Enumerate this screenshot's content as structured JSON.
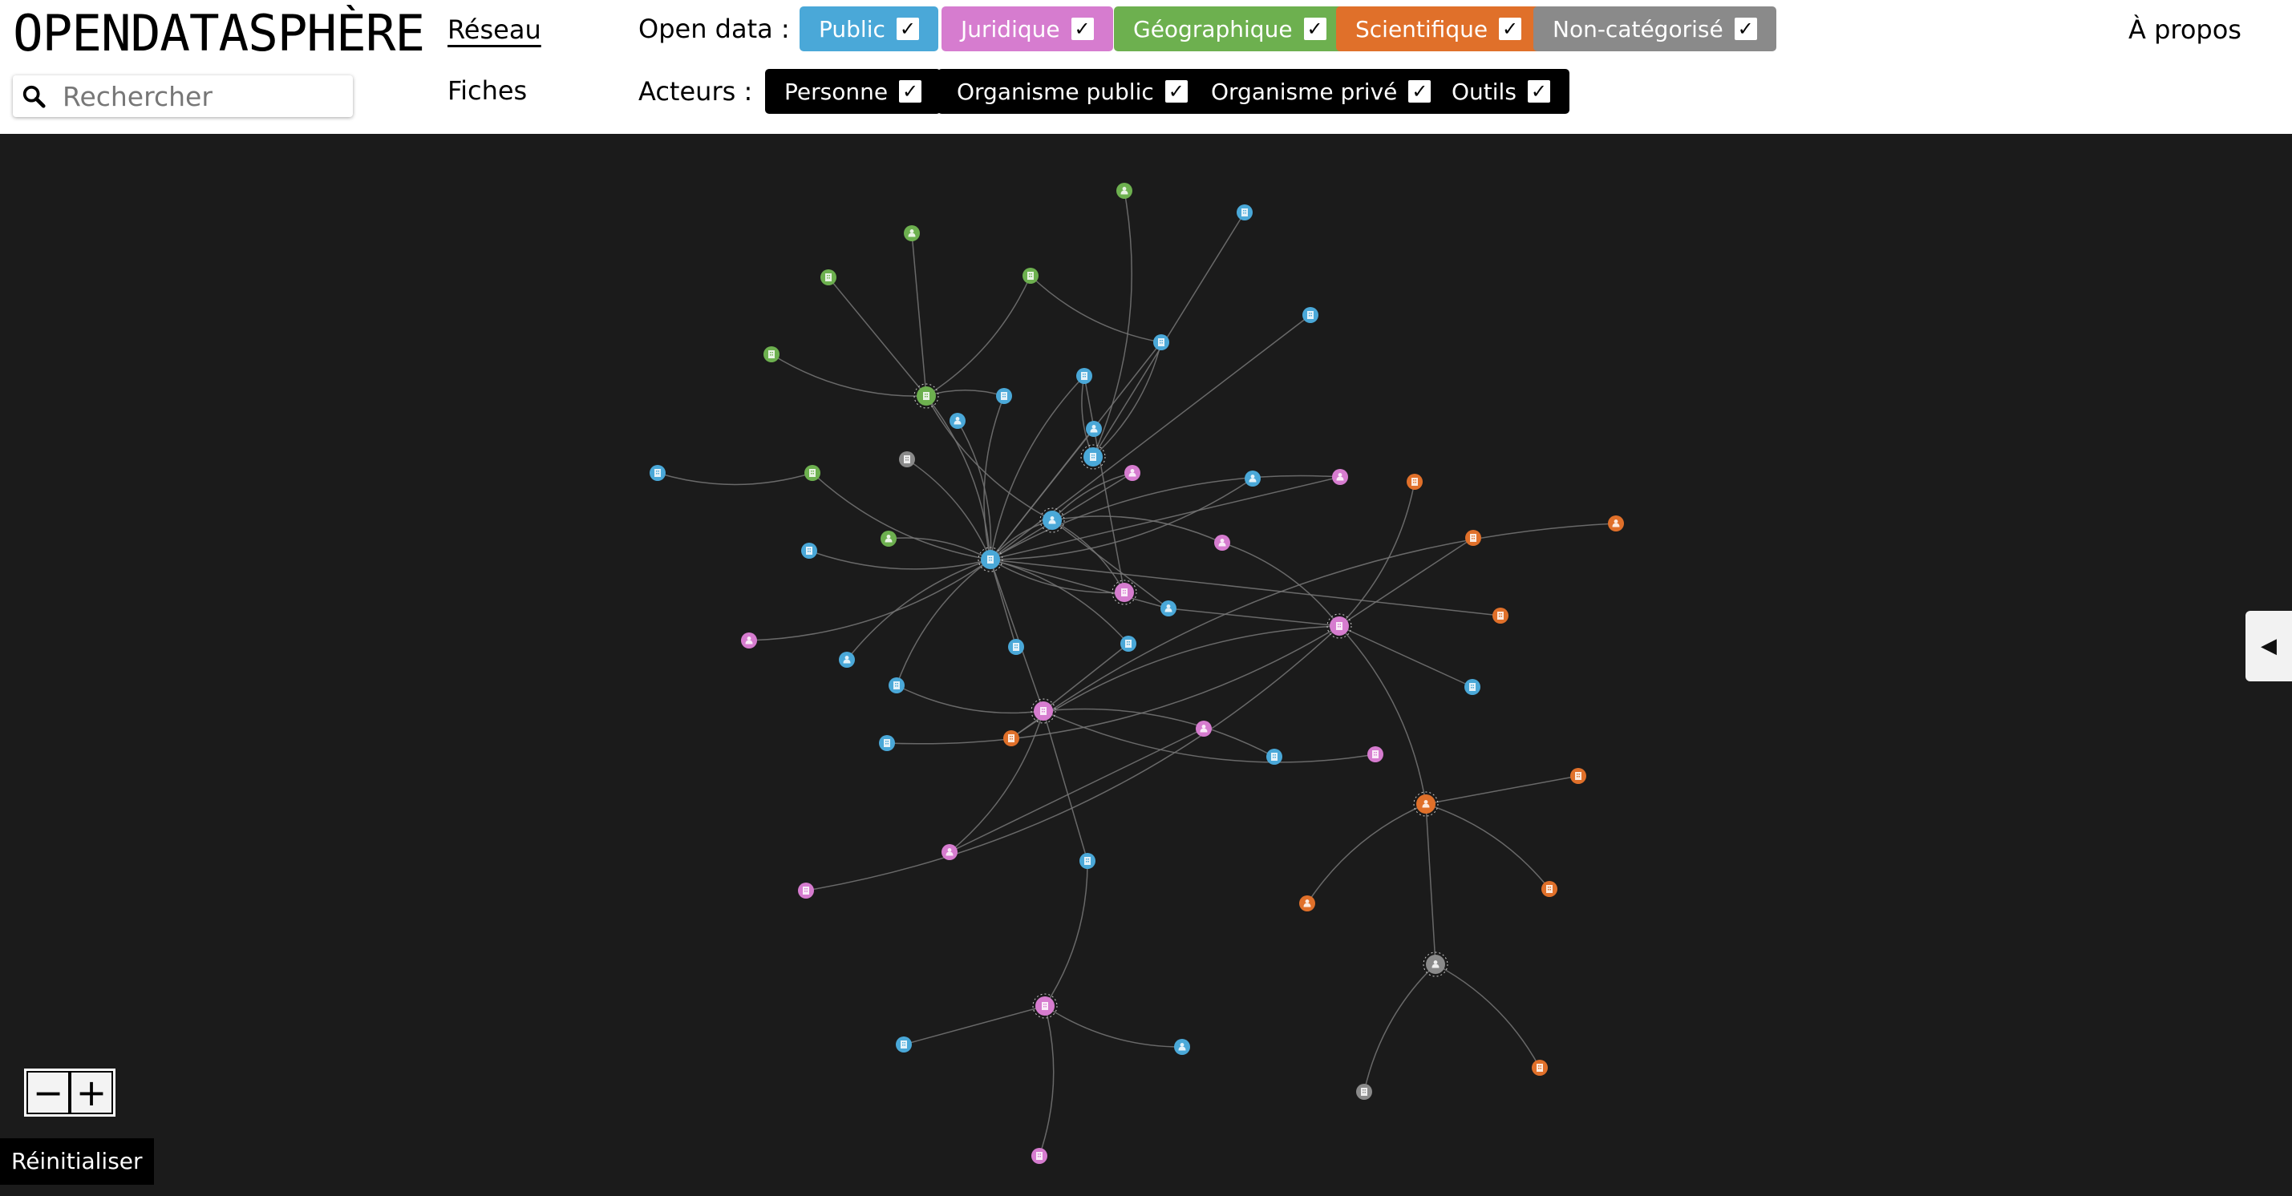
{
  "header": {
    "logo": "OPENDATASPHÈRE",
    "search": {
      "placeholder": "Rechercher",
      "value": ""
    },
    "nav": {
      "reseau": "Réseau",
      "fiches": "Fiches",
      "apropos": "À propos"
    },
    "opendata_label": "Open data :",
    "acteurs_label": "Acteurs :",
    "opendata_filters": [
      {
        "label": "Public",
        "color": "#4aa8d8",
        "checked": true
      },
      {
        "label": "Juridique",
        "color": "#d67ccf",
        "checked": true
      },
      {
        "label": "Géographique",
        "color": "#6db04f",
        "checked": true
      },
      {
        "label": "Scientifique",
        "color": "#e0702a",
        "checked": true
      },
      {
        "label": "Non-catégorisé",
        "color": "#8a8a8a",
        "checked": true
      }
    ],
    "acteurs_filters": [
      {
        "label": "Personne",
        "checked": true
      },
      {
        "label": "Organisme public",
        "checked": true
      },
      {
        "label": "Organisme privé",
        "checked": true
      },
      {
        "label": "Outils",
        "checked": true
      }
    ]
  },
  "controls": {
    "zoom_out": "−",
    "zoom_in": "+",
    "reset": "Réinitialiser",
    "side_toggle": "◀"
  },
  "colors": {
    "public": "#4aa8d8",
    "juridique": "#d67ccf",
    "geographique": "#6db04f",
    "scientifique": "#e0702a",
    "non_categorise": "#8a8a8a",
    "edge": "#777777",
    "background": "#1b1b1b"
  },
  "graph": {
    "nodes": [
      {
        "id": "g1",
        "cat": "geographique",
        "icon": "person-icon"
      },
      {
        "id": "b1",
        "cat": "public",
        "icon": "building-icon"
      },
      {
        "id": "g2",
        "cat": "geographique",
        "icon": "person-icon"
      },
      {
        "id": "g3",
        "cat": "geographique",
        "icon": "building-icon"
      },
      {
        "id": "g4",
        "cat": "geographique",
        "icon": "building-icon"
      },
      {
        "id": "b2",
        "cat": "public",
        "icon": "building-icon"
      },
      {
        "id": "b3",
        "cat": "public",
        "icon": "building-icon"
      },
      {
        "id": "g5",
        "cat": "geographique",
        "icon": "building-icon"
      },
      {
        "id": "G",
        "cat": "geographique",
        "icon": "building-icon"
      },
      {
        "id": "b4",
        "cat": "public",
        "icon": "building-icon"
      },
      {
        "id": "b5",
        "cat": "public",
        "icon": "building-icon"
      },
      {
        "id": "b6",
        "cat": "public",
        "icon": "person-icon"
      },
      {
        "id": "b7",
        "cat": "public",
        "icon": "building-icon"
      },
      {
        "id": "n1",
        "cat": "non_categorise",
        "icon": "building-icon"
      },
      {
        "id": "b8",
        "cat": "public",
        "icon": "person-icon"
      },
      {
        "id": "g6",
        "cat": "geographique",
        "icon": "building-icon"
      },
      {
        "id": "p1",
        "cat": "juridique",
        "icon": "person-icon"
      },
      {
        "id": "b9",
        "cat": "public",
        "icon": "person-icon"
      },
      {
        "id": "p2",
        "cat": "juridique",
        "icon": "person-icon"
      },
      {
        "id": "o1",
        "cat": "scientifique",
        "icon": "building-icon"
      },
      {
        "id": "o2",
        "cat": "scientifique",
        "icon": "building-icon"
      },
      {
        "id": "o3",
        "cat": "scientifique",
        "icon": "person-icon"
      },
      {
        "id": "B2",
        "cat": "public",
        "icon": "person-icon"
      },
      {
        "id": "b10",
        "cat": "public",
        "icon": "building-icon"
      },
      {
        "id": "g7",
        "cat": "geographique",
        "icon": "person-icon"
      },
      {
        "id": "p3",
        "cat": "juridique",
        "icon": "person-icon"
      },
      {
        "id": "B",
        "cat": "public",
        "icon": "building-icon"
      },
      {
        "id": "b11",
        "cat": "public",
        "icon": "building-icon"
      },
      {
        "id": "P",
        "cat": "juridique",
        "icon": "building-icon"
      },
      {
        "id": "b12",
        "cat": "public",
        "icon": "person-icon"
      },
      {
        "id": "o4",
        "cat": "scientifique",
        "icon": "building-icon"
      },
      {
        "id": "p4",
        "cat": "juridique",
        "icon": "person-icon"
      },
      {
        "id": "b13",
        "cat": "public",
        "icon": "person-icon"
      },
      {
        "id": "b14",
        "cat": "public",
        "icon": "building-icon"
      },
      {
        "id": "b15",
        "cat": "public",
        "icon": "building-icon"
      },
      {
        "id": "b16",
        "cat": "public",
        "icon": "building-icon"
      },
      {
        "id": "P2",
        "cat": "juridique",
        "icon": "building-icon"
      },
      {
        "id": "b17",
        "cat": "public",
        "icon": "building-icon"
      },
      {
        "id": "b18",
        "cat": "public",
        "icon": "building-icon"
      },
      {
        "id": "o5",
        "cat": "scientifique",
        "icon": "building-icon"
      },
      {
        "id": "p5",
        "cat": "juridique",
        "icon": "person-icon"
      },
      {
        "id": "b19",
        "cat": "public",
        "icon": "building-icon"
      },
      {
        "id": "p6",
        "cat": "juridique",
        "icon": "building-icon"
      },
      {
        "id": "P3",
        "cat": "juridique",
        "icon": "building-icon"
      },
      {
        "id": "O",
        "cat": "scientifique",
        "icon": "person-icon"
      },
      {
        "id": "o6",
        "cat": "scientifique",
        "icon": "building-icon"
      },
      {
        "id": "o7",
        "cat": "scientifique",
        "icon": "person-icon"
      },
      {
        "id": "o8",
        "cat": "scientifique",
        "icon": "building-icon"
      },
      {
        "id": "p7",
        "cat": "juridique",
        "icon": "person-icon"
      },
      {
        "id": "p8",
        "cat": "juridique",
        "icon": "building-icon"
      },
      {
        "id": "b20",
        "cat": "public",
        "icon": "building-icon"
      },
      {
        "id": "P4",
        "cat": "juridique",
        "icon": "building-icon"
      },
      {
        "id": "b21",
        "cat": "public",
        "icon": "building-icon"
      },
      {
        "id": "b22",
        "cat": "public",
        "icon": "person-icon"
      },
      {
        "id": "N",
        "cat": "non_categorise",
        "icon": "person-icon"
      },
      {
        "id": "n2",
        "cat": "non_categorise",
        "icon": "building-icon"
      },
      {
        "id": "o9",
        "cat": "scientifique",
        "icon": "building-icon"
      },
      {
        "id": "p9",
        "cat": "juridique",
        "icon": "building-icon"
      }
    ],
    "edges": [
      [
        "g1",
        "b10"
      ],
      [
        "b1",
        "b10"
      ],
      [
        "b10",
        "b3"
      ],
      [
        "b10",
        "b4"
      ],
      [
        "g2",
        "G"
      ],
      [
        "g3",
        "b3"
      ],
      [
        "g3",
        "G"
      ],
      [
        "g4",
        "G"
      ],
      [
        "g5",
        "G"
      ],
      [
        "b6",
        "B"
      ],
      [
        "b2",
        "B"
      ],
      [
        "b5",
        "B"
      ],
      [
        "G",
        "B"
      ],
      [
        "b3",
        "B"
      ],
      [
        "b4",
        "B"
      ],
      [
        "n1",
        "B"
      ],
      [
        "b8",
        "B"
      ],
      [
        "g6",
        "B"
      ],
      [
        "b9",
        "B"
      ],
      [
        "b12",
        "B"
      ],
      [
        "B2",
        "B"
      ],
      [
        "g7",
        "B"
      ],
      [
        "p2",
        "B"
      ],
      [
        "b11",
        "B"
      ],
      [
        "P",
        "B"
      ],
      [
        "b14",
        "B"
      ],
      [
        "b15",
        "B"
      ],
      [
        "b16",
        "B"
      ],
      [
        "P2",
        "B"
      ],
      [
        "p4",
        "B"
      ],
      [
        "b13",
        "B"
      ],
      [
        "o4",
        "B"
      ],
      [
        "b7",
        "g6"
      ],
      [
        "B2",
        "P"
      ],
      [
        "b4",
        "P"
      ],
      [
        "p1",
        "B2"
      ],
      [
        "B2",
        "p3"
      ],
      [
        "B2",
        "b12"
      ],
      [
        "G",
        "B2"
      ],
      [
        "P2",
        "b19"
      ],
      [
        "P2",
        "b20"
      ],
      [
        "P2",
        "p6"
      ],
      [
        "b20",
        "P4"
      ],
      [
        "P4",
        "b21"
      ],
      [
        "P4",
        "b22"
      ],
      [
        "P4",
        "p9"
      ],
      [
        "p5",
        "p7"
      ],
      [
        "p7",
        "P2"
      ],
      [
        "p3",
        "P3"
      ],
      [
        "b12",
        "P3"
      ],
      [
        "b18",
        "P3"
      ],
      [
        "o1",
        "P3"
      ],
      [
        "o2",
        "P3"
      ],
      [
        "o3",
        "o5"
      ],
      [
        "o5",
        "P3"
      ],
      [
        "b17",
        "P3"
      ],
      [
        "p8",
        "P3"
      ],
      [
        "P3",
        "O"
      ],
      [
        "O",
        "o6"
      ],
      [
        "O",
        "o7"
      ],
      [
        "O",
        "o8"
      ],
      [
        "O",
        "N"
      ],
      [
        "N",
        "n2"
      ],
      [
        "N",
        "o9"
      ],
      [
        "p1",
        "B"
      ],
      [
        "p2",
        "B"
      ],
      [
        "G",
        "b5"
      ],
      [
        "b15",
        "P2"
      ],
      [
        "b16",
        "P2"
      ]
    ]
  }
}
